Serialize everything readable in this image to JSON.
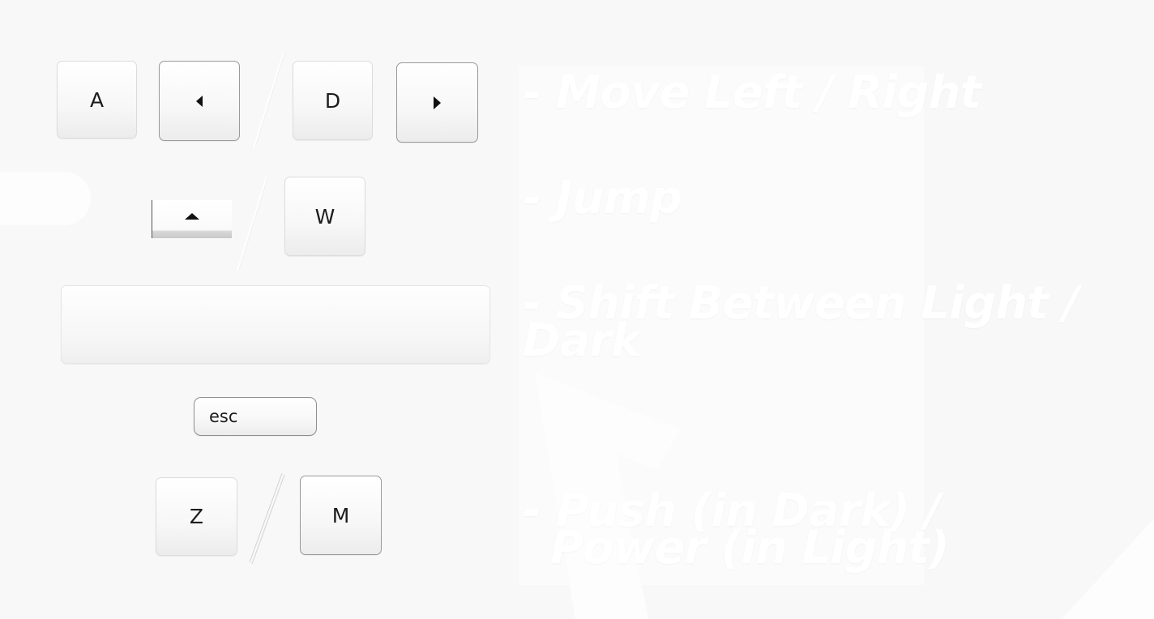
{
  "keys": {
    "a": "A",
    "d": "D",
    "w": "W",
    "esc": "esc",
    "z": "Z",
    "m": "M"
  },
  "icons": {
    "left_arrow": "left-triangle",
    "right_arrow": "right-triangle",
    "up_arrow": "up-triangle",
    "slash": "forward-slash"
  },
  "descriptions": {
    "move": "- Move Left / Right",
    "jump": "- Jump",
    "shift_line1": "- Shift Between Light /",
    "shift_line2": "Dark",
    "action_line1": "- Push (in Dark) /",
    "action_line2": "Power (in Light)"
  },
  "colors": {
    "background": "#f8f8f8",
    "key_face": "#ffffff",
    "key_label": "#1c1c1c",
    "description_text": "#ffffff"
  }
}
